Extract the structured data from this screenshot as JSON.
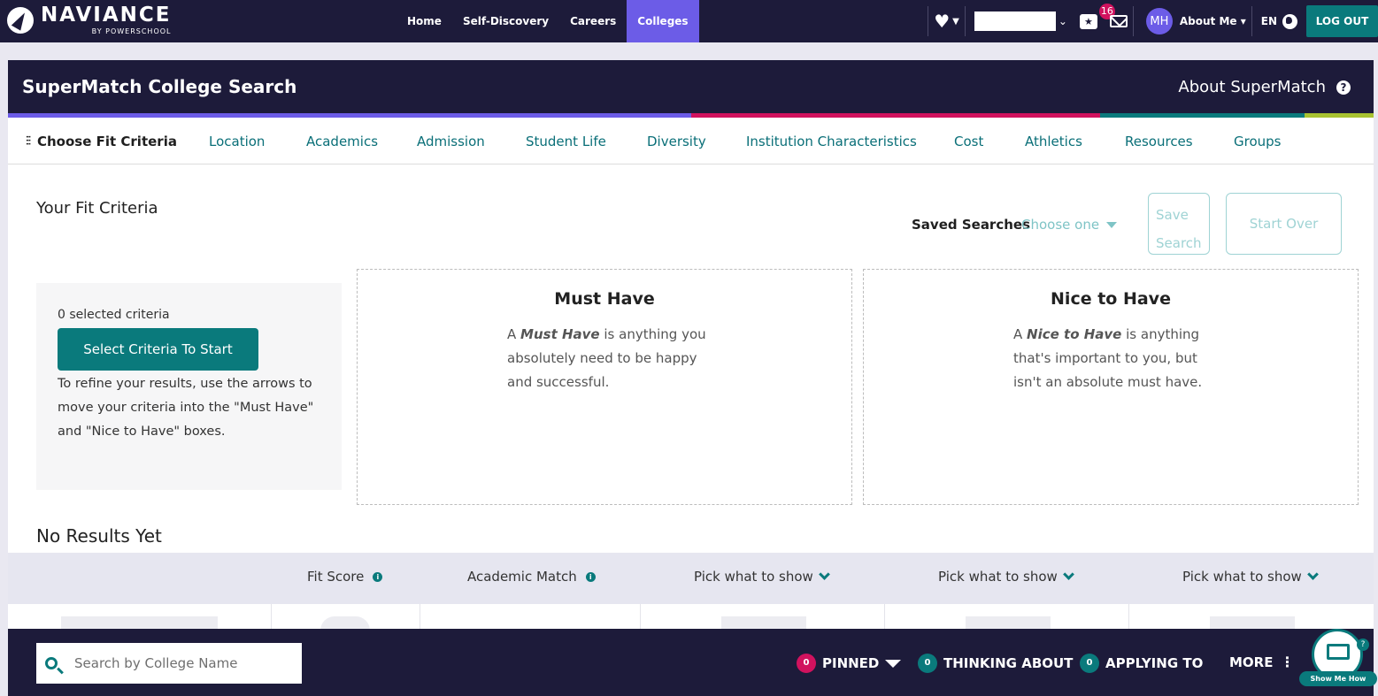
{
  "topnav": {
    "brand": "NAVIANCE",
    "brand_sub": "BY POWERSCHOOL",
    "links": [
      "Home",
      "Self-Discovery",
      "Careers",
      "Colleges"
    ],
    "active_link": "Colleges",
    "message_count": "16",
    "avatar_initials": "MH",
    "about_me": "About Me ▾",
    "language": "EN",
    "logout": "LOG OUT"
  },
  "header": {
    "title": "SuperMatch College Search",
    "about": "About SuperMatch"
  },
  "tabs": {
    "choose": "Choose Fit Criteria",
    "items": [
      "Location",
      "Academics",
      "Admission",
      "Student Life",
      "Diversity",
      "Institution Characteristics",
      "Cost",
      "Athletics",
      "Resources",
      "Groups"
    ]
  },
  "fit": {
    "title": "Your Fit Criteria",
    "saved_label": "Saved Searches",
    "saved_placeholder": "Choose one",
    "save_line1": "Save",
    "save_line2": "Search",
    "start_over": "Start Over"
  },
  "criteria": {
    "count": "0 selected criteria",
    "button": "Select Criteria To Start",
    "help": "To refine your results, use the arrows to move your criteria into the \"Must Have\" and \"Nice to Have\" boxes."
  },
  "must_have": {
    "title": "Must Have",
    "prefix": "A",
    "em": "Must Have",
    "text": "is anything you absolutely need to be happy and successful."
  },
  "nice_to_have": {
    "title": "Nice to Have",
    "prefix": "A",
    "em": "Nice to Have",
    "text": "is anything that's important to you, but isn't an absolute must have."
  },
  "results": {
    "title": "No Results Yet",
    "columns": [
      "Fit Score",
      "Academic Match",
      "Pick what to show",
      "Pick what to show",
      "Pick what to show"
    ]
  },
  "bottombar": {
    "search_placeholder": "Search by College Name",
    "pinned_count": "0",
    "pinned": "PINNED",
    "thinking_count": "0",
    "thinking": "THINKING ABOUT",
    "applying_count": "0",
    "applying": "APPLYING TO",
    "more": "MORE",
    "show_me_badge": "?",
    "show_me": "Show Me How"
  },
  "colors": {
    "navy": "#1d1b3a",
    "purple": "#6c5ce7",
    "teal": "#0a7a7c",
    "magenta": "#d1125e",
    "lime": "#a8c230"
  },
  "icons": [
    "heart-icon",
    "star-bubble-icon",
    "mail-icon",
    "globe-icon",
    "help-icon",
    "sliders-icon",
    "info-icon",
    "chevron-down-icon",
    "search-icon",
    "more-icon",
    "show-me-how-icon"
  ]
}
